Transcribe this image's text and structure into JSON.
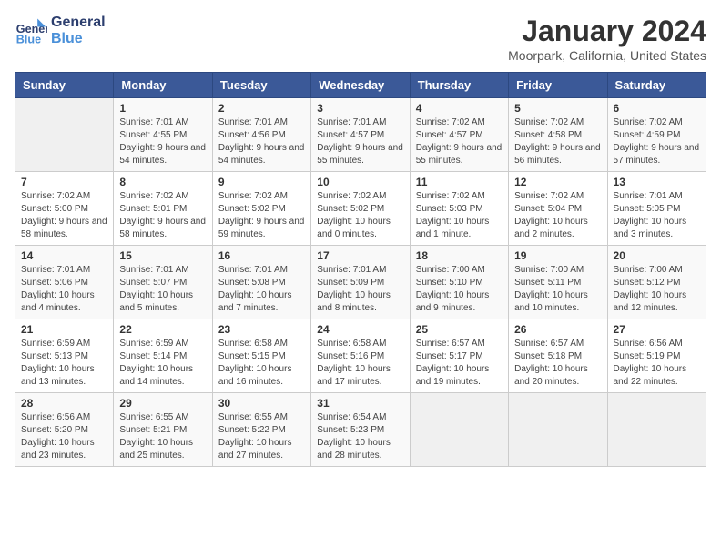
{
  "header": {
    "logo_text_general": "General",
    "logo_text_blue": "Blue",
    "month_title": "January 2024",
    "location": "Moorpark, California, United States"
  },
  "weekdays": [
    "Sunday",
    "Monday",
    "Tuesday",
    "Wednesday",
    "Thursday",
    "Friday",
    "Saturday"
  ],
  "weeks": [
    [
      {
        "day": "",
        "sunrise": "",
        "sunset": "",
        "daylight": ""
      },
      {
        "day": "1",
        "sunrise": "Sunrise: 7:01 AM",
        "sunset": "Sunset: 4:55 PM",
        "daylight": "Daylight: 9 hours and 54 minutes."
      },
      {
        "day": "2",
        "sunrise": "Sunrise: 7:01 AM",
        "sunset": "Sunset: 4:56 PM",
        "daylight": "Daylight: 9 hours and 54 minutes."
      },
      {
        "day": "3",
        "sunrise": "Sunrise: 7:01 AM",
        "sunset": "Sunset: 4:57 PM",
        "daylight": "Daylight: 9 hours and 55 minutes."
      },
      {
        "day": "4",
        "sunrise": "Sunrise: 7:02 AM",
        "sunset": "Sunset: 4:57 PM",
        "daylight": "Daylight: 9 hours and 55 minutes."
      },
      {
        "day": "5",
        "sunrise": "Sunrise: 7:02 AM",
        "sunset": "Sunset: 4:58 PM",
        "daylight": "Daylight: 9 hours and 56 minutes."
      },
      {
        "day": "6",
        "sunrise": "Sunrise: 7:02 AM",
        "sunset": "Sunset: 4:59 PM",
        "daylight": "Daylight: 9 hours and 57 minutes."
      }
    ],
    [
      {
        "day": "7",
        "sunrise": "Sunrise: 7:02 AM",
        "sunset": "Sunset: 5:00 PM",
        "daylight": "Daylight: 9 hours and 58 minutes."
      },
      {
        "day": "8",
        "sunrise": "Sunrise: 7:02 AM",
        "sunset": "Sunset: 5:01 PM",
        "daylight": "Daylight: 9 hours and 58 minutes."
      },
      {
        "day": "9",
        "sunrise": "Sunrise: 7:02 AM",
        "sunset": "Sunset: 5:02 PM",
        "daylight": "Daylight: 9 hours and 59 minutes."
      },
      {
        "day": "10",
        "sunrise": "Sunrise: 7:02 AM",
        "sunset": "Sunset: 5:02 PM",
        "daylight": "Daylight: 10 hours and 0 minutes."
      },
      {
        "day": "11",
        "sunrise": "Sunrise: 7:02 AM",
        "sunset": "Sunset: 5:03 PM",
        "daylight": "Daylight: 10 hours and 1 minute."
      },
      {
        "day": "12",
        "sunrise": "Sunrise: 7:02 AM",
        "sunset": "Sunset: 5:04 PM",
        "daylight": "Daylight: 10 hours and 2 minutes."
      },
      {
        "day": "13",
        "sunrise": "Sunrise: 7:01 AM",
        "sunset": "Sunset: 5:05 PM",
        "daylight": "Daylight: 10 hours and 3 minutes."
      }
    ],
    [
      {
        "day": "14",
        "sunrise": "Sunrise: 7:01 AM",
        "sunset": "Sunset: 5:06 PM",
        "daylight": "Daylight: 10 hours and 4 minutes."
      },
      {
        "day": "15",
        "sunrise": "Sunrise: 7:01 AM",
        "sunset": "Sunset: 5:07 PM",
        "daylight": "Daylight: 10 hours and 5 minutes."
      },
      {
        "day": "16",
        "sunrise": "Sunrise: 7:01 AM",
        "sunset": "Sunset: 5:08 PM",
        "daylight": "Daylight: 10 hours and 7 minutes."
      },
      {
        "day": "17",
        "sunrise": "Sunrise: 7:01 AM",
        "sunset": "Sunset: 5:09 PM",
        "daylight": "Daylight: 10 hours and 8 minutes."
      },
      {
        "day": "18",
        "sunrise": "Sunrise: 7:00 AM",
        "sunset": "Sunset: 5:10 PM",
        "daylight": "Daylight: 10 hours and 9 minutes."
      },
      {
        "day": "19",
        "sunrise": "Sunrise: 7:00 AM",
        "sunset": "Sunset: 5:11 PM",
        "daylight": "Daylight: 10 hours and 10 minutes."
      },
      {
        "day": "20",
        "sunrise": "Sunrise: 7:00 AM",
        "sunset": "Sunset: 5:12 PM",
        "daylight": "Daylight: 10 hours and 12 minutes."
      }
    ],
    [
      {
        "day": "21",
        "sunrise": "Sunrise: 6:59 AM",
        "sunset": "Sunset: 5:13 PM",
        "daylight": "Daylight: 10 hours and 13 minutes."
      },
      {
        "day": "22",
        "sunrise": "Sunrise: 6:59 AM",
        "sunset": "Sunset: 5:14 PM",
        "daylight": "Daylight: 10 hours and 14 minutes."
      },
      {
        "day": "23",
        "sunrise": "Sunrise: 6:58 AM",
        "sunset": "Sunset: 5:15 PM",
        "daylight": "Daylight: 10 hours and 16 minutes."
      },
      {
        "day": "24",
        "sunrise": "Sunrise: 6:58 AM",
        "sunset": "Sunset: 5:16 PM",
        "daylight": "Daylight: 10 hours and 17 minutes."
      },
      {
        "day": "25",
        "sunrise": "Sunrise: 6:57 AM",
        "sunset": "Sunset: 5:17 PM",
        "daylight": "Daylight: 10 hours and 19 minutes."
      },
      {
        "day": "26",
        "sunrise": "Sunrise: 6:57 AM",
        "sunset": "Sunset: 5:18 PM",
        "daylight": "Daylight: 10 hours and 20 minutes."
      },
      {
        "day": "27",
        "sunrise": "Sunrise: 6:56 AM",
        "sunset": "Sunset: 5:19 PM",
        "daylight": "Daylight: 10 hours and 22 minutes."
      }
    ],
    [
      {
        "day": "28",
        "sunrise": "Sunrise: 6:56 AM",
        "sunset": "Sunset: 5:20 PM",
        "daylight": "Daylight: 10 hours and 23 minutes."
      },
      {
        "day": "29",
        "sunrise": "Sunrise: 6:55 AM",
        "sunset": "Sunset: 5:21 PM",
        "daylight": "Daylight: 10 hours and 25 minutes."
      },
      {
        "day": "30",
        "sunrise": "Sunrise: 6:55 AM",
        "sunset": "Sunset: 5:22 PM",
        "daylight": "Daylight: 10 hours and 27 minutes."
      },
      {
        "day": "31",
        "sunrise": "Sunrise: 6:54 AM",
        "sunset": "Sunset: 5:23 PM",
        "daylight": "Daylight: 10 hours and 28 minutes."
      },
      {
        "day": "",
        "sunrise": "",
        "sunset": "",
        "daylight": ""
      },
      {
        "day": "",
        "sunrise": "",
        "sunset": "",
        "daylight": ""
      },
      {
        "day": "",
        "sunrise": "",
        "sunset": "",
        "daylight": ""
      }
    ]
  ]
}
